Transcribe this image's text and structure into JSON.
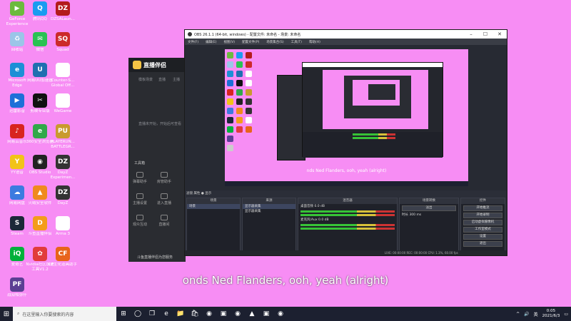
{
  "desktop": {
    "icons": [
      {
        "label": "GeForce Experience",
        "color": "#6cba3e",
        "glyph": "▶"
      },
      {
        "label": "腾讯QQ",
        "color": "#1b9bf0",
        "glyph": "Q"
      },
      {
        "label": "DZSALaun...",
        "color": "#b31b1b",
        "glyph": "DZ"
      },
      {
        "label": "回收站",
        "color": "#9bc5e8",
        "glyph": "♻"
      },
      {
        "label": "微信",
        "color": "#2ac253",
        "glyph": "✉"
      },
      {
        "label": "Squad",
        "color": "#cc2a2a",
        "glyph": "SQ"
      },
      {
        "label": "Microsoft Edge",
        "color": "#1c8fd6",
        "glyph": "e"
      },
      {
        "label": "网易UU加速器",
        "color": "#1f6fb0",
        "glyph": "U"
      },
      {
        "label": "Counter-S... Global Off...",
        "color": "#ffffff",
        "glyph": ""
      },
      {
        "label": "迅雷影音",
        "color": "#1d6fd8",
        "glyph": "▶"
      },
      {
        "label": "剪映专业版",
        "color": "#111111",
        "glyph": "✂"
      },
      {
        "label": "WeGame",
        "color": "#ffffff",
        "glyph": ""
      },
      {
        "label": "网易云音乐",
        "color": "#d8241f",
        "glyph": "♪"
      },
      {
        "label": "360安全浏览器",
        "color": "#31a84a",
        "glyph": "e"
      },
      {
        "label": "PLAYERUN... BATTLEGR...",
        "color": "#c99a2e",
        "glyph": "PU"
      },
      {
        "label": "YY语音",
        "color": "#f2c319",
        "glyph": "Y"
      },
      {
        "label": "OBS Studio",
        "color": "#222222",
        "glyph": "◉"
      },
      {
        "label": "DayZ Experimen...",
        "color": "#333333",
        "glyph": "DZ"
      },
      {
        "label": "网易网盘",
        "color": "#3c7be0",
        "glyph": "☁"
      },
      {
        "label": "火绒安全软件",
        "color": "#f08a1d",
        "glyph": "▲"
      },
      {
        "label": "DayZ",
        "color": "#333333",
        "glyph": "DZ"
      },
      {
        "label": "Steam",
        "color": "#1b2838",
        "glyph": "S"
      },
      {
        "label": "斗鱼直播伴侣",
        "color": "#f49c1a",
        "glyph": "D"
      },
      {
        "label": "Arma 3",
        "color": "#ffffff",
        "glyph": ""
      },
      {
        "label": "爱奇艺",
        "color": "#00b13b",
        "glyph": "iQ"
      },
      {
        "label": "Nvidia社区加速工具V1.2",
        "color": "#e13b3b",
        "glyph": "✿"
      },
      {
        "label": "CF生化道具助手",
        "color": "#e8641b",
        "glyph": "CF"
      },
      {
        "label": "战双帕弥什",
        "color": "#5b3f93",
        "glyph": "PF"
      }
    ]
  },
  "zhibo_window": {
    "brand": "直播伴侣",
    "tabs": [
      "模板场景",
      "直播",
      "主播"
    ],
    "placeholder": "直播未开始，开始后可查看直播画面",
    "tools_title": "工具箱",
    "tools": [
      "弹幕助手",
      "房管助手",
      "主播设置",
      "进入直播",
      "观众互动",
      "直播间"
    ],
    "status": "斗鱼直播伴侣为您服务"
  },
  "obs": {
    "title": "OBS 26.1.1 (64-bit, windows) - 配置文件: 未命名 - 场景: 未命名",
    "menu": [
      "文件(F)",
      "编辑(E)",
      "视图(V)",
      "配置文件(P)",
      "场景集合(S)",
      "工具(T)",
      "帮助(H)"
    ],
    "preview_caption": "nds Ned Flanders, ooh, yeah (alright)",
    "scenes_panel": "场景",
    "scenes": [
      "场景"
    ],
    "sources_panel": "来源",
    "sources": [
      "显示器采集",
      "显示器采集"
    ],
    "mixer_panel": "混音器",
    "mixer": [
      {
        "name": "桌面音频",
        "level": "0.0 dB"
      },
      {
        "name": "麦克风/Aux",
        "level": "0.0 dB"
      }
    ],
    "transition_panel": "场景转换",
    "transition": "淡出",
    "duration_label": "时长",
    "duration": "300 ms",
    "controls_panel": "控件",
    "controls": [
      "开始推流",
      "开始录制",
      "启动虚拟摄像机",
      "工作室模式",
      "设置",
      "退出"
    ],
    "filter_bar": "滤镜 属性 ● 显示",
    "status": "LIVE: 00:00:00   REC: 00:00:00   CPU: 1.3%, 60.00 fps"
  },
  "subtitle": "onds Ned Flanders, ooh, yeah (alright)",
  "taskbar": {
    "search_placeholder": "在这里输入你要搜索的内容",
    "apps": [
      "⊞",
      "◯",
      "❒",
      "e",
      "📁",
      "🛍",
      "◉",
      "▣",
      "◉",
      "▲",
      "▣",
      "◉"
    ],
    "time": "0:05",
    "date": "2021/6/3",
    "lang": "英"
  }
}
